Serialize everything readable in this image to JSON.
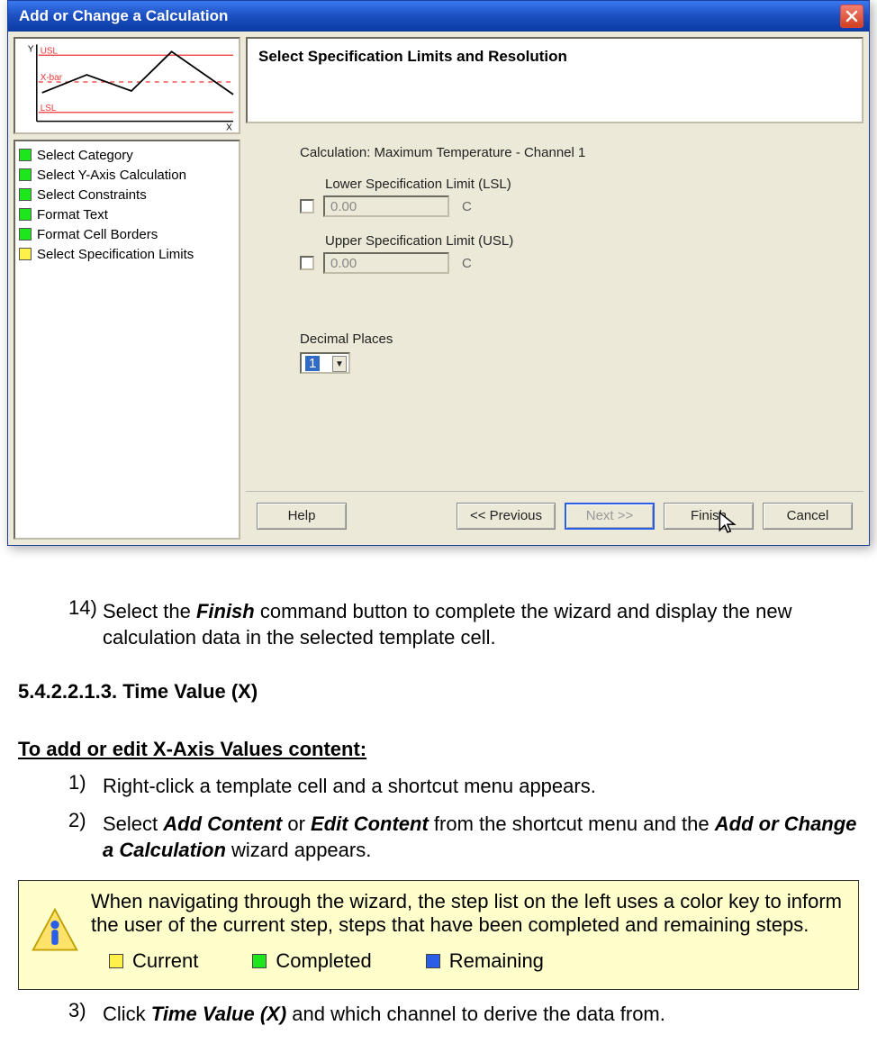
{
  "dialog": {
    "title": "Add or Change a Calculation",
    "heading": "Select Specification Limits and Resolution",
    "calc_label": "Calculation: Maximum Temperature - Channel 1",
    "lsl_label": "Lower Specification Limit (LSL)",
    "lsl_value": "0.00",
    "lsl_unit": "C",
    "usl_label": "Upper Specification Limit (USL)",
    "usl_value": "0.00",
    "usl_unit": "C",
    "decimal_label": "Decimal Places",
    "decimal_value": "1",
    "steps": [
      {
        "label": "Select Category",
        "state": "green"
      },
      {
        "label": "Select Y-Axis Calculation",
        "state": "green"
      },
      {
        "label": "Select Constraints",
        "state": "green"
      },
      {
        "label": "Format Text",
        "state": "green"
      },
      {
        "label": "Format Cell Borders",
        "state": "green"
      },
      {
        "label": "Select Specification Limits",
        "state": "yellow"
      }
    ],
    "buttons": {
      "help": "Help",
      "prev": "<< Previous",
      "next": "Next >>",
      "finish": "Finish",
      "cancel": "Cancel"
    },
    "thumb": {
      "y_label": "Y",
      "x_label": "X",
      "usl": "USL",
      "xbar": "X-bar",
      "lsl": "LSL"
    }
  },
  "doc": {
    "step14_num": "14)",
    "step14_a": "Select the ",
    "step14_b": "Finish",
    "step14_c": " command button to complete the wizard and display the new calculation data in the selected template cell.",
    "section": "5.4.2.2.1.3. Time Value (X)",
    "subhead": "To add or edit X-Axis Values content:",
    "s1_num": "1)",
    "s1": "Right-click a template cell and a shortcut menu appears.",
    "s2_num": "2)",
    "s2_a": "Select ",
    "s2_b": "Add Content",
    "s2_c": " or ",
    "s2_d": "Edit Content",
    "s2_e": " from the shortcut menu and the ",
    "s2_f": "Add or Change a Calculation",
    "s2_g": " wizard appears.",
    "note": "When navigating through the wizard, the step list on the left uses a color key to inform the user of the current step, steps that have been completed and remaining steps.",
    "legend": {
      "current": "Current",
      "completed": "Completed",
      "remaining": "Remaining"
    },
    "s3_num": "3)",
    "s3_a": "Click ",
    "s3_b": "Time Value (X)",
    "s3_c": " and which channel to derive the data from."
  }
}
